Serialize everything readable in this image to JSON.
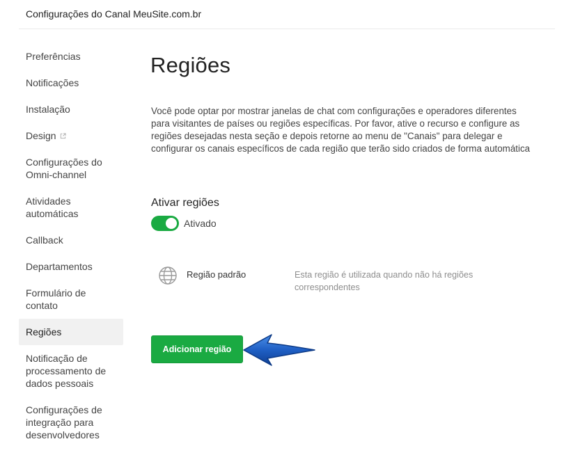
{
  "header": {
    "title": "Configurações do Canal MeuSite.com.br"
  },
  "sidebar": {
    "items": [
      {
        "label": "Preferências"
      },
      {
        "label": "Notificações"
      },
      {
        "label": "Instalação"
      },
      {
        "label": "Design"
      },
      {
        "label": "Configurações do Omni-channel"
      },
      {
        "label": "Atividades automáticas"
      },
      {
        "label": "Callback"
      },
      {
        "label": "Departamentos"
      },
      {
        "label": "Formulário de contato"
      },
      {
        "label": "Regiões",
        "active": true
      },
      {
        "label": "Notificação de processamento de dados pessoais"
      },
      {
        "label": "Configurações de integração para desenvolvedores"
      }
    ]
  },
  "main": {
    "title": "Regiões",
    "description": "Você pode optar por mostrar janelas de chat com configurações e operadores diferentes para visitantes de países ou regiões específicas. Por favor, ative o recurso e configure as regiões desejadas nesta seção e depois retorne ao menu de \"Canais\" para delegar e configurar os canais específicos de cada região que terão sido criados de forma automática",
    "toggle_section": {
      "label": "Ativar regiões",
      "state_label": "Ativado",
      "enabled": true
    },
    "regions": [
      {
        "name": "Região padrão",
        "description": "Esta região é utilizada quando não há regiões correspondentes",
        "icon": "globe-icon"
      }
    ],
    "add_button_label": "Adicionar região"
  },
  "colors": {
    "accent_green": "#1aaa42",
    "arrow_blue": "#1f5fc4",
    "active_bg": "#f1f1f1"
  }
}
